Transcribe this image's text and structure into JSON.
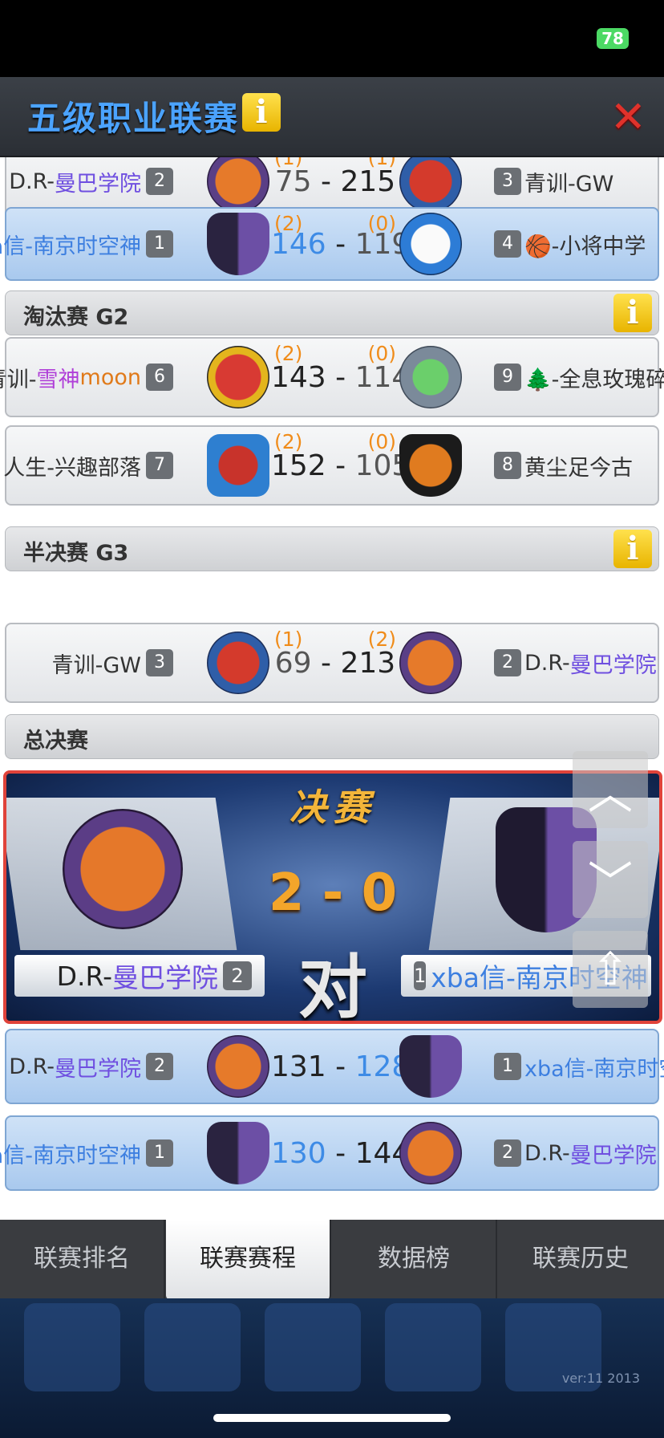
{
  "status_bar": {
    "battery": "78"
  },
  "header": {
    "title": "五级职业联赛",
    "info_icon": "i",
    "close_icon": "✕"
  },
  "colors": {
    "accent_blue": "#4ba3ff",
    "win_orange": "#f08c1a",
    "close_red": "#e0322b",
    "final_border": "#e0433a"
  },
  "matches_top": [
    {
      "left_prefix": "D.R-",
      "left_name": "曼巴学院",
      "left_seed": "2",
      "left_wins": "(1)",
      "left_score": "75",
      "right_score": "215",
      "right_wins": "(1)",
      "right_seed": "3",
      "right_name": "青训-GW"
    },
    {
      "left_name": "xba信-南京时空神",
      "left_seed": "1",
      "left_wins": "(2)",
      "left_score": "146",
      "right_score": "119",
      "right_wins": "(0)",
      "right_seed": "4",
      "right_name": "🏀-小将中学"
    }
  ],
  "section_g2": {
    "title": "淘汰赛 G2",
    "info_icon": "i"
  },
  "matches_g2": [
    {
      "left_prefix": "青训-",
      "left_mid": "雪神",
      "left_suffix": "moon",
      "left_seed": "6",
      "left_wins": "(2)",
      "left_score": "143",
      "right_score": "114",
      "right_wins": "(0)",
      "right_seed": "9",
      "right_name": "🌲-全息玫瑰碎片"
    },
    {
      "left_name": "人生-兴趣部落",
      "left_seed": "7",
      "left_wins": "(2)",
      "left_score": "152",
      "right_score": "105",
      "right_wins": "(0)",
      "right_seed": "8",
      "right_name": "黄尘足今古"
    }
  ],
  "section_g3": {
    "title": "半决赛 G3",
    "info_icon": "i"
  },
  "matches_g3": [
    {
      "left_name": "青训-GW",
      "left_seed": "3",
      "left_wins": "(1)",
      "left_score": "69",
      "right_score": "213",
      "right_wins": "(2)",
      "right_seed": "2",
      "right_prefix": "D.R-",
      "right_name": "曼巴学院"
    }
  ],
  "section_final": {
    "title": "总决赛"
  },
  "final": {
    "label": "决赛",
    "score": "2 - 0",
    "vs": "对",
    "left_prefix": "D.R-",
    "left_name": "曼巴学院",
    "left_seed": "2",
    "right_seed": "1",
    "right_name": "xba信-南京时空神"
  },
  "matches_final": [
    {
      "left_prefix": "D.R-",
      "left_name": "曼巴学院",
      "left_seed": "2",
      "left_score": "131",
      "right_score": "128",
      "right_seed": "1",
      "right_name": "xba信-南京时空神"
    },
    {
      "left_name": "xba信-南京时空神",
      "left_seed": "1",
      "left_score": "130",
      "right_score": "144",
      "right_seed": "2",
      "right_prefix": "D.R-",
      "right_name": "曼巴学院"
    }
  ],
  "side_buttons": {
    "up": "︿",
    "down": "﹀",
    "top": "⇧"
  },
  "tabs": [
    {
      "label": "联赛排名"
    },
    {
      "label": "联赛赛程"
    },
    {
      "label": "数据榜"
    },
    {
      "label": "联赛历史"
    }
  ],
  "version": "ver:11  2013"
}
